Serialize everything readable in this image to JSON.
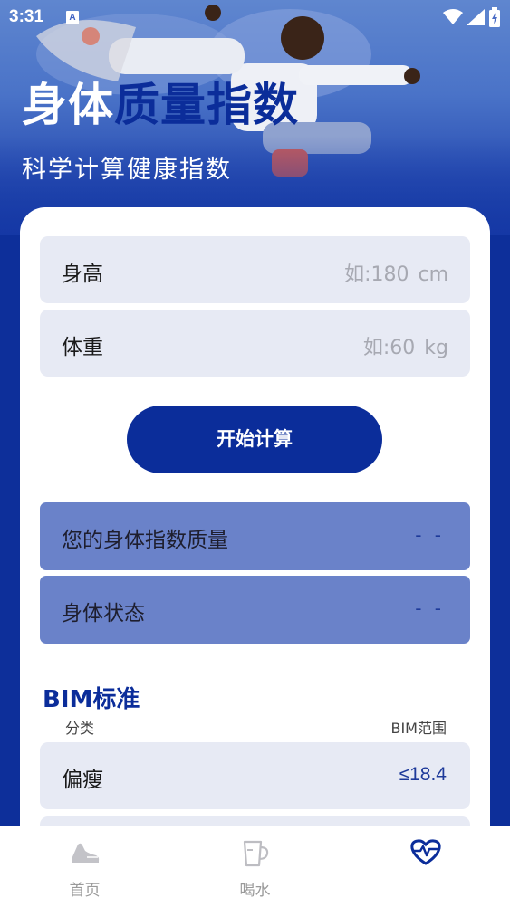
{
  "status_bar": {
    "time": "3:31",
    "notification_icon": "a-letter-icon"
  },
  "hero": {
    "title_part1": "身体",
    "title_part2": "质量指数",
    "subtitle": "科学计算健康指数"
  },
  "form": {
    "height_label": "身高",
    "height_placeholder": "如:180",
    "height_unit": "cm",
    "weight_label": "体重",
    "weight_placeholder": "如:60",
    "weight_unit": "kg",
    "calculate_button": "开始计算"
  },
  "results": {
    "bmi_label": "您的身体指数质量",
    "bmi_value": "- -",
    "status_label": "身体状态",
    "status_value": "- -"
  },
  "bim_standard": {
    "title": "BIM标准",
    "col_category": "分类",
    "col_range": "BIM范围",
    "rows": [
      {
        "category": "偏瘦",
        "range": "≤18.4"
      },
      {
        "category": "",
        "range": ""
      }
    ]
  },
  "tabs": [
    {
      "label": "首页",
      "icon": "shoe-icon",
      "active": false
    },
    {
      "label": "喝水",
      "icon": "cup-icon",
      "active": false
    },
    {
      "label": "",
      "icon": "heart-pulse-icon",
      "active": true
    }
  ],
  "colors": {
    "brand": "#0b2d9a",
    "result_bg": "#6a82c9",
    "field_bg": "#e7eaf4"
  }
}
